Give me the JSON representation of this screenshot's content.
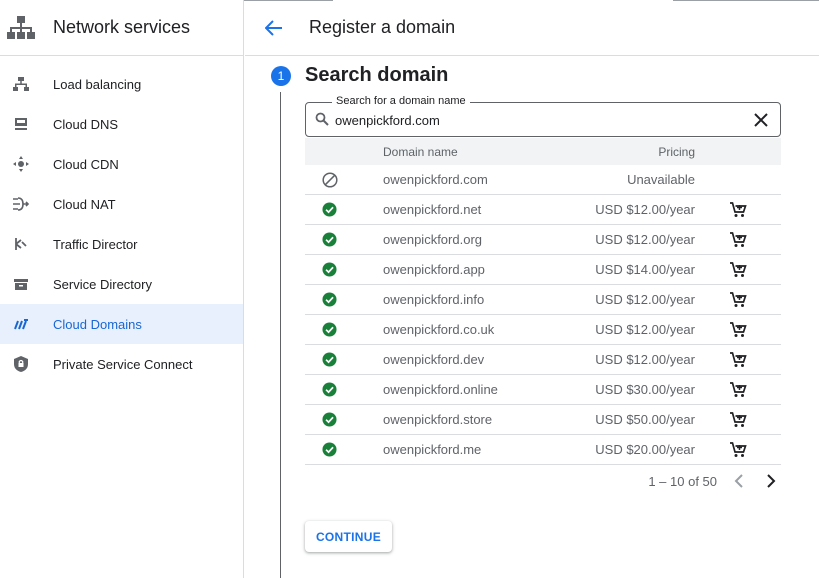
{
  "sidebar": {
    "title": "Network services",
    "items": [
      {
        "label": "Load balancing",
        "icon": "load-balancing-icon"
      },
      {
        "label": "Cloud DNS",
        "icon": "cloud-dns-icon"
      },
      {
        "label": "Cloud CDN",
        "icon": "cloud-cdn-icon"
      },
      {
        "label": "Cloud NAT",
        "icon": "cloud-nat-icon"
      },
      {
        "label": "Traffic Director",
        "icon": "traffic-director-icon"
      },
      {
        "label": "Service Directory",
        "icon": "service-directory-icon"
      },
      {
        "label": "Cloud Domains",
        "icon": "cloud-domains-icon",
        "active": true
      },
      {
        "label": "Private Service Connect",
        "icon": "shield-lock-icon"
      }
    ]
  },
  "header": {
    "title": "Register a domain"
  },
  "step": {
    "number": "1",
    "title": "Search domain"
  },
  "search": {
    "label": "Search for a domain name",
    "value": "owenpickford.com"
  },
  "table": {
    "columns": {
      "name": "Domain name",
      "pricing": "Pricing"
    },
    "rows": [
      {
        "name": "owenpickford.com",
        "price": "Unavailable",
        "available": false
      },
      {
        "name": "owenpickford.net",
        "price": "USD $12.00/year",
        "available": true
      },
      {
        "name": "owenpickford.org",
        "price": "USD $12.00/year",
        "available": true
      },
      {
        "name": "owenpickford.app",
        "price": "USD $14.00/year",
        "available": true
      },
      {
        "name": "owenpickford.info",
        "price": "USD $12.00/year",
        "available": true
      },
      {
        "name": "owenpickford.co.uk",
        "price": "USD $12.00/year",
        "available": true
      },
      {
        "name": "owenpickford.dev",
        "price": "USD $12.00/year",
        "available": true
      },
      {
        "name": "owenpickford.online",
        "price": "USD $30.00/year",
        "available": true
      },
      {
        "name": "owenpickford.store",
        "price": "USD $50.00/year",
        "available": true
      },
      {
        "name": "owenpickford.me",
        "price": "USD $20.00/year",
        "available": true
      }
    ]
  },
  "pagination": {
    "range": "1 – 10 of 50"
  },
  "actions": {
    "continue_label": "CONTINUE"
  },
  "colors": {
    "accent": "#1a73e8",
    "available": "#188038",
    "active_bg": "#e8f0fe"
  }
}
